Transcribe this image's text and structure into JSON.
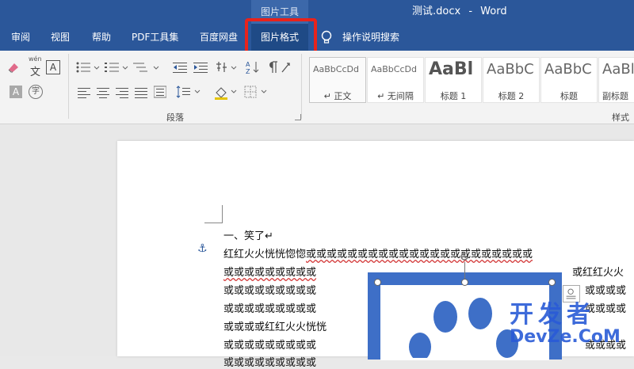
{
  "titlebar": {
    "context_label": "图片工具",
    "doc_name": "测试.docx",
    "separator": "-",
    "app_name": "Word"
  },
  "tabs": [
    {
      "label": "审阅"
    },
    {
      "label": "视图"
    },
    {
      "label": "帮助"
    },
    {
      "label": "PDF工具集"
    },
    {
      "label": "百度网盘"
    },
    {
      "label": "图片格式"
    }
  ],
  "tell_me": "操作说明搜索",
  "ribbon": {
    "font_group": {
      "wen_label": "wén",
      "wen_char": "文",
      "char_box": "A",
      "char_a": "A",
      "char_zi": "字"
    },
    "paragraph_label": "段落",
    "styles_label": "样式",
    "styles": [
      {
        "sample": "AaBbCcDd",
        "name": "↵ 正文"
      },
      {
        "sample": "AaBbCcDd",
        "name": "↵ 无间隔"
      },
      {
        "sample": "AaBl",
        "name": "标题 1"
      },
      {
        "sample": "AaBbC",
        "name": "标题 2"
      },
      {
        "sample": "AaBbC",
        "name": "标题"
      },
      {
        "sample": "AaBl",
        "name": "副标题"
      }
    ]
  },
  "document": {
    "heading": "一、笑了↵",
    "line1_plain": "红红火火恍恍惚惚",
    "line1_err": "或或或或或或或或或或或或或或或或或或或或或或",
    "left_lines": [
      "或或或或或或或或或",
      "或或或或或或或或或",
      "或或或或或或或或或",
      "或或或或红红火火恍恍",
      "或或或或或或或或或",
      "或或或或或或或或或"
    ],
    "right_lines": [
      "或红红火火",
      "或或或或",
      "或或或或",
      "惚惚或或",
      "或或或或"
    ]
  },
  "watermark": {
    "cn": "开发者",
    "en": "DevZe.CoM"
  },
  "colors": {
    "accent": "#2b579a",
    "highlight": "#e8231b",
    "image_blue": "#3e6fc7"
  }
}
